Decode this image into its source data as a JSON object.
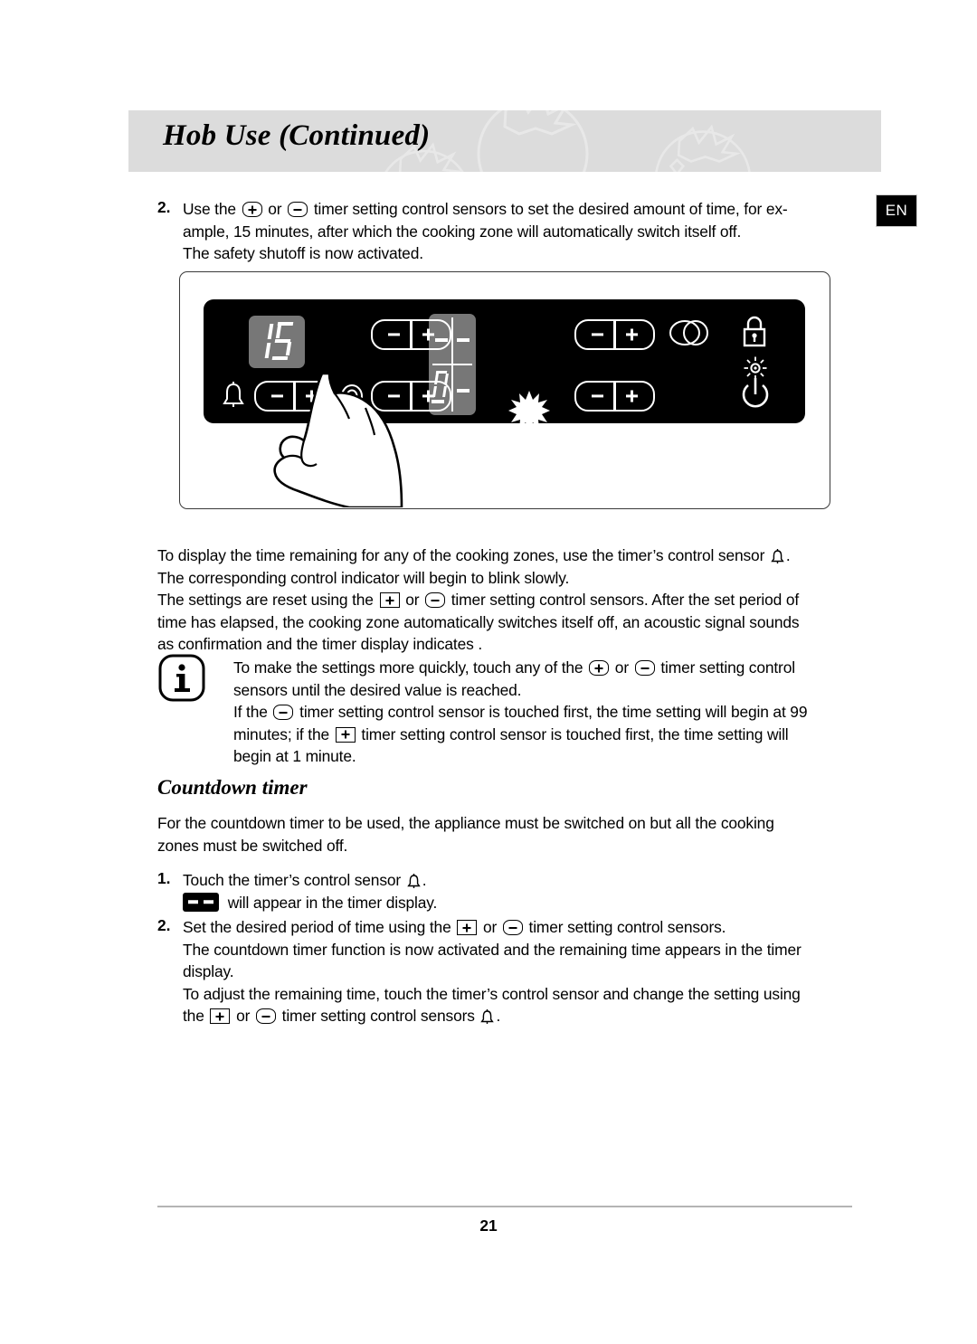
{
  "header": {
    "title": "Hob Use (Continued)",
    "watermark": "tomato-outline-pattern"
  },
  "language_badge": {
    "label": "EN"
  },
  "steps_top": {
    "number": "2.",
    "line1_a": "Use the",
    "line1_b": "or",
    "line1_c": "timer setting control sensors to set the desired amount of time, for ex-",
    "line2": "ample, 15 minutes, after which the cooking zone will automatically switch itself off.",
    "line3": "The safety shutoff is now activated."
  },
  "figure": {
    "caption_name": "hob-control-panel-illustration",
    "timer_display_value": "15",
    "zone_display": {
      "top_left": "-",
      "top_right": "-",
      "bottom_left": "0",
      "bottom_right": "-",
      "blink_indicator": "bottom-left"
    },
    "icons": [
      "bell-icon",
      "single-zone-icon",
      "dual-zone-icon",
      "lock-icon",
      "indicator-light-icon",
      "power-icon"
    ],
    "rockers": [
      "timer-minus-plus-rocker",
      "zone1-minus-plus-rocker",
      "zone2-minus-plus-rocker",
      "zone3-minus-plus-rocker",
      "zone4-minus-plus-rocker"
    ],
    "hand": "pointing-hand-touching-plus"
  },
  "paragraph_a": {
    "line1_a": "To display the time remaining for any of the cooking zones, use the timer’s control sensor",
    "line1_b": ".",
    "line2": "The corresponding control indicator will begin to blink slowly.",
    "line3_a": "The settings are reset using the",
    "line3_b": "or",
    "line3_c": "timer setting control sensors. After the set period of",
    "line4": "time has elapsed, the cooking zone automatically switches itself off, an acoustic signal sounds",
    "line5": "as confirmation and the timer display indicates ."
  },
  "note": {
    "icon": "info-icon",
    "line1_a": "To make the settings more quickly, touch any of the",
    "line1_b": "or",
    "line1_c": "timer setting control",
    "line2": "sensors until the desired value is reached.",
    "line3_a": "If the",
    "line3_b": "timer setting control sensor is touched first, the time setting will begin at 99",
    "line4_a": "minutes; if the",
    "line4_b": "timer setting control sensor is touched first, the time setting will",
    "line5": "begin at 1 minute."
  },
  "section": {
    "heading": "Countdown timer",
    "intro_line1": "For the countdown timer to be used, the appliance must be switched on but all the cooking",
    "intro_line2": "zones must be switched off."
  },
  "steps_bottom": [
    {
      "number": "1.",
      "line1_a": "Touch the timer’s control sensor",
      "line1_b": ".",
      "line2": "will appear in the timer display."
    },
    {
      "number": "2.",
      "line1_a": "Set the desired period of time using the",
      "line1_b": "or",
      "line1_c": "timer setting control sensors.",
      "line2": "The countdown timer function is now activated and the remaining time appears in the timer",
      "line3": "display.",
      "line4": "To adjust the remaining time, touch the timer’s control sensor and change the setting using",
      "line5_a": "the",
      "line5_b": "or",
      "line5_c": "timer setting control sensors",
      "line5_d": "."
    }
  ],
  "footer": {
    "page_number": "21"
  },
  "colors": {
    "header_band": "#dcdcdc",
    "panel_black": "#000000",
    "display_gray": "#777777",
    "rule": "#b4b4b4"
  }
}
